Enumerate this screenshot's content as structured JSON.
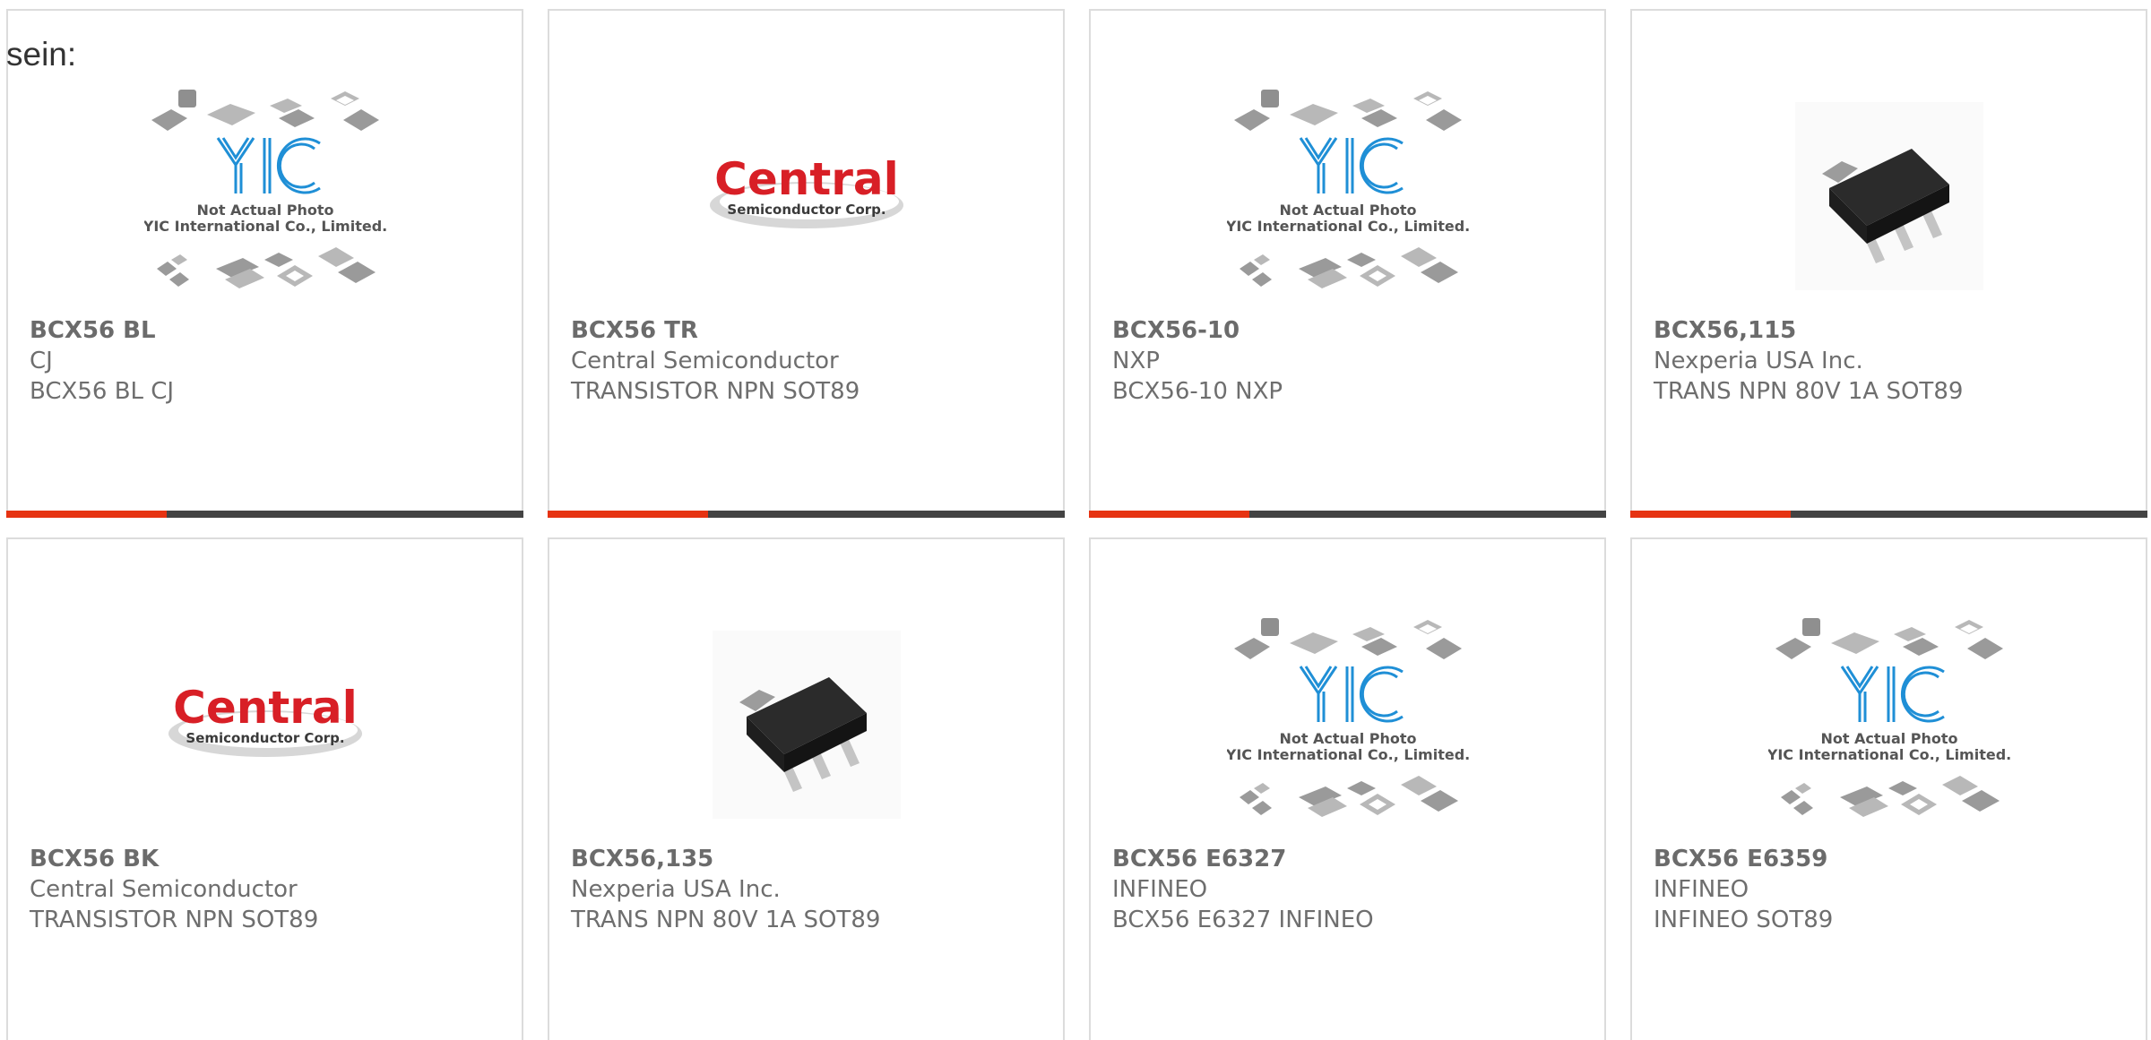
{
  "intro_text": "sein:",
  "colors": {
    "accent": "#e63312",
    "bar": "#434343",
    "border": "#dcdcdc",
    "text": "#6e6e6e",
    "yic_blue": "#1f8fd6",
    "central_red": "#d81f26"
  },
  "products": [
    {
      "part": "BCX56 BL",
      "manufacturer": "CJ",
      "description": "BCX56 BL CJ",
      "image": "yic-placeholder",
      "image_text_1": "Not Actual Photo",
      "image_text_2": "YIC International Co., Limited.",
      "progress": 0.31
    },
    {
      "part": "BCX56 TR",
      "manufacturer": "Central Semiconductor",
      "description": "TRANSISTOR NPN SOT89",
      "image": "central-logo",
      "logo_word": "Central",
      "logo_sub": "Semiconductor Corp.",
      "progress": 0.31
    },
    {
      "part": "BCX56-10",
      "manufacturer": "NXP",
      "description": "BCX56-10 NXP",
      "image": "yic-placeholder",
      "image_text_1": "Not Actual Photo",
      "image_text_2": "YIC International Co., Limited.",
      "progress": 0.31
    },
    {
      "part": "BCX56,115",
      "manufacturer": "Nexperia USA Inc.",
      "description": "TRANS NPN 80V 1A SOT89",
      "image": "sot89-photo",
      "progress": 0.31
    },
    {
      "part": "BCX56 BK",
      "manufacturer": "Central Semiconductor",
      "description": "TRANSISTOR NPN SOT89",
      "image": "central-logo",
      "logo_word": "Central",
      "logo_sub": "Semiconductor Corp."
    },
    {
      "part": "BCX56,135",
      "manufacturer": "Nexperia USA Inc.",
      "description": "TRANS NPN 80V 1A SOT89",
      "image": "sot89-photo"
    },
    {
      "part": "BCX56 E6327",
      "manufacturer": "INFINEO",
      "description": "BCX56 E6327 INFINEO",
      "image": "yic-placeholder",
      "image_text_1": "Not Actual Photo",
      "image_text_2": "YIC International Co., Limited."
    },
    {
      "part": "BCX56 E6359",
      "manufacturer": "INFINEO",
      "description": "INFINEO SOT89",
      "image": "yic-placeholder",
      "image_text_1": "Not Actual Photo",
      "image_text_2": "YIC International Co., Limited."
    }
  ]
}
